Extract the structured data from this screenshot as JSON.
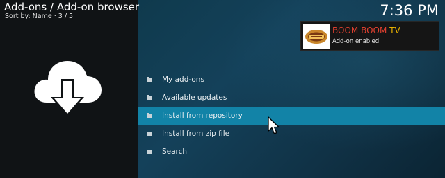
{
  "header": {
    "title": "Add-ons / Add-on browser",
    "sort_label": "Sort by: Name",
    "position": "3 / 5",
    "clock": "7:36 PM"
  },
  "hero": {
    "icon": "cloud-download-icon"
  },
  "menu": {
    "items": [
      {
        "label": "My add-ons",
        "icon": "folder-icon",
        "focused": false
      },
      {
        "label": "Available updates",
        "icon": "folder-icon",
        "focused": false
      },
      {
        "label": "Install from repository",
        "icon": "folder-icon",
        "focused": true
      },
      {
        "label": "Install from zip file",
        "icon": "square-icon",
        "focused": false
      },
      {
        "label": "Search",
        "icon": "square-icon",
        "focused": false
      }
    ]
  },
  "notification": {
    "title_part1": "BOOM BOOM",
    "title_part2": "TV",
    "message": "Add-on enabled",
    "thumbnail": "boom-boom-logo"
  },
  "colors": {
    "focus": "#1283a7",
    "background": "#14313f",
    "left_panel": "#101315",
    "title_red": "#e0402f",
    "title_gold": "#e9b200"
  }
}
